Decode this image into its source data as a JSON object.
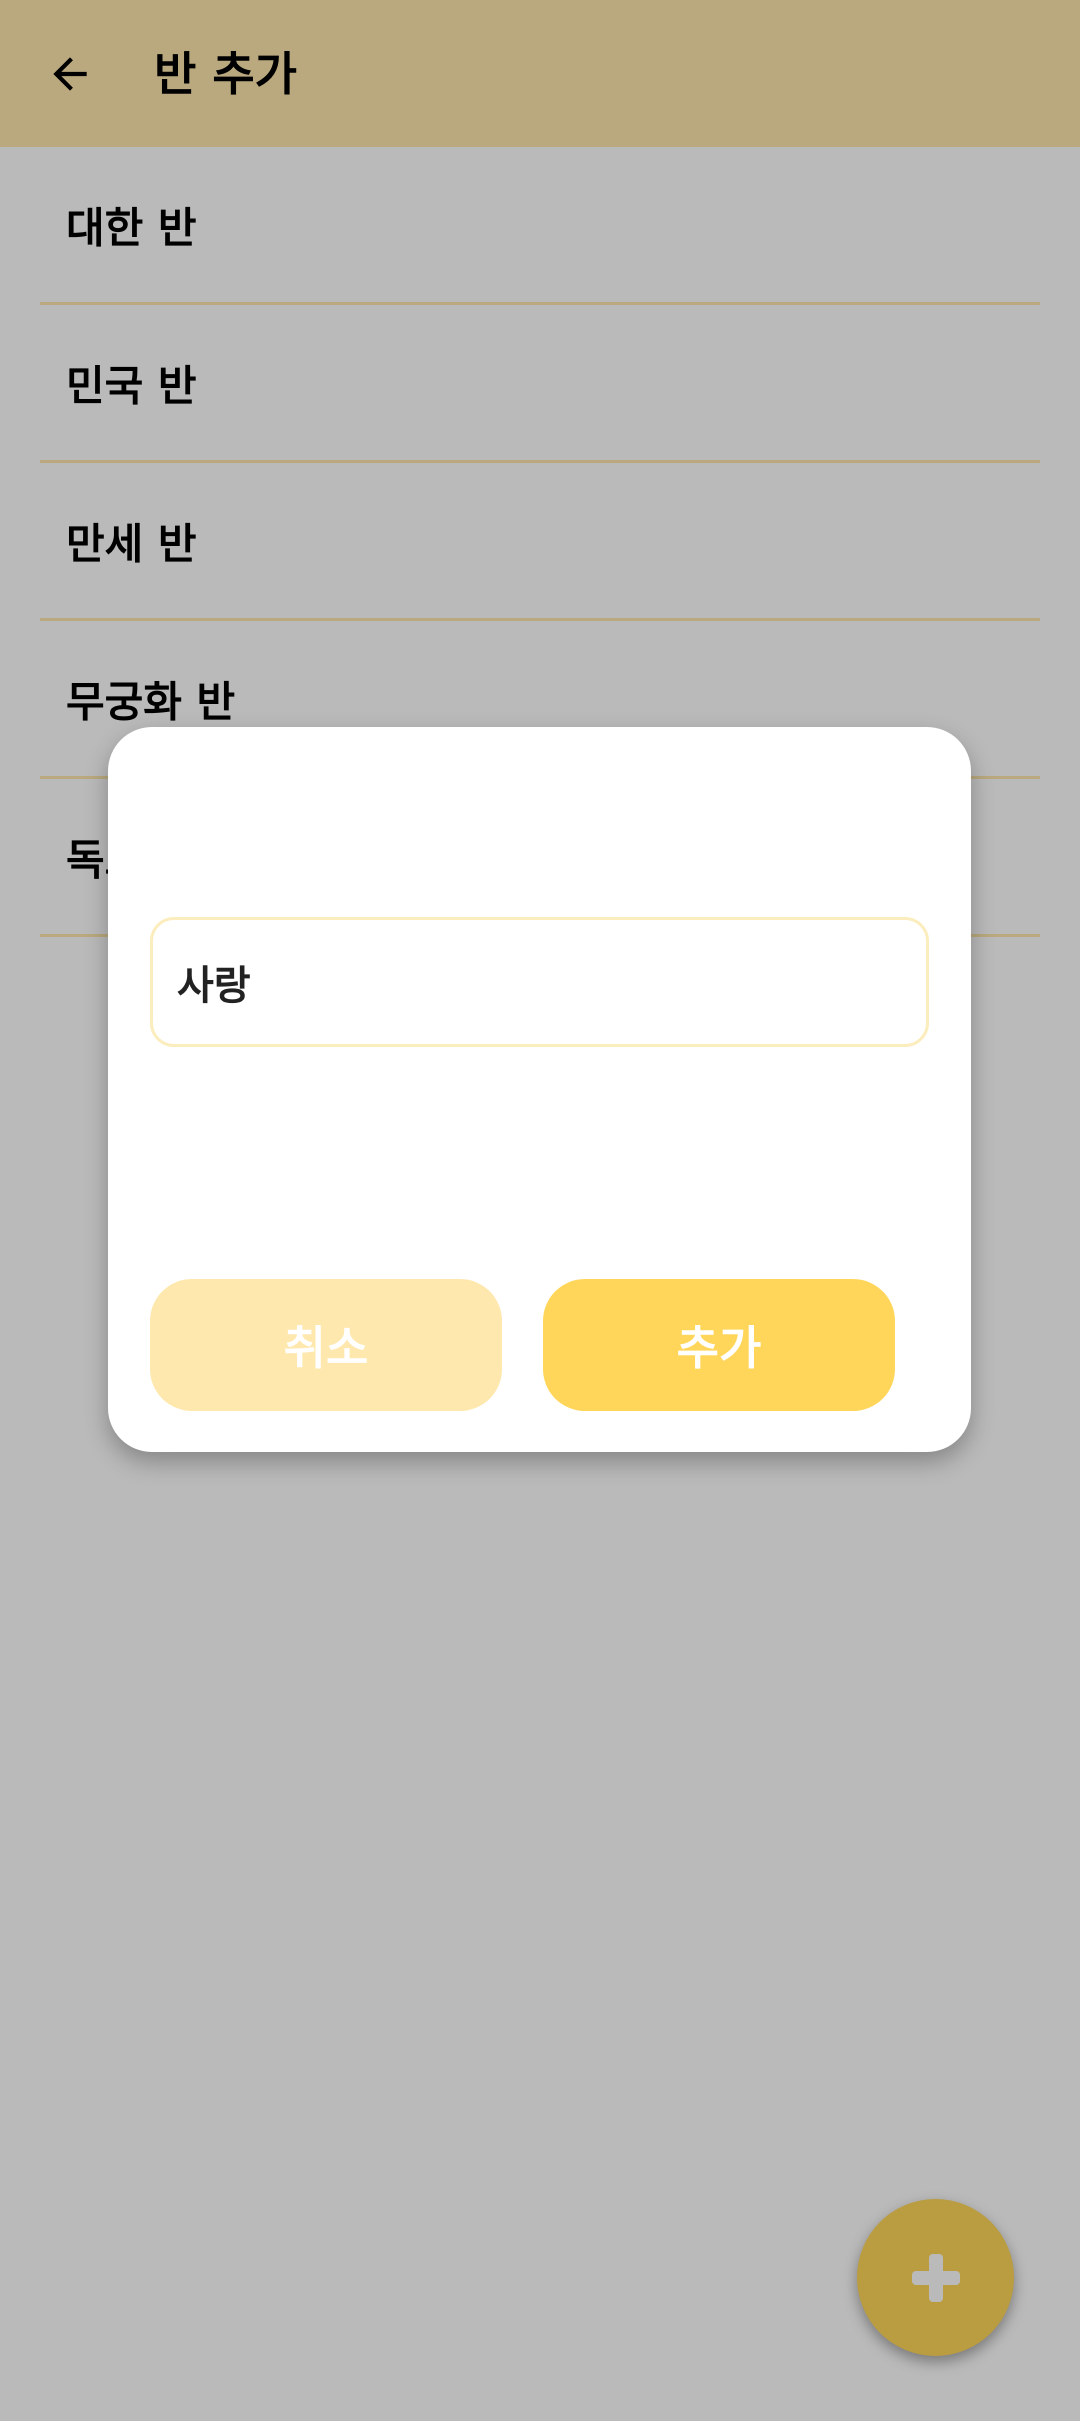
{
  "app_bar": {
    "title": "반 추가",
    "back_icon": "arrow-left-icon",
    "color": "#ffe8ad"
  },
  "class_list": [
    {
      "label": "대한 반"
    },
    {
      "label": "민국 반"
    },
    {
      "label": "만세 반"
    },
    {
      "label": "무궁화 반"
    },
    {
      "label": "독도 반"
    }
  ],
  "dialog": {
    "input": {
      "value": "사랑",
      "placeholder": ""
    },
    "cancel_label": "취소",
    "add_label": "추가"
  },
  "fab": {
    "icon": "plus-icon",
    "color": "#ffd65a"
  },
  "colors": {
    "accent": "#ffd65a",
    "accent_light": "#ffe8ad",
    "scrim": "#bcbcbc"
  }
}
